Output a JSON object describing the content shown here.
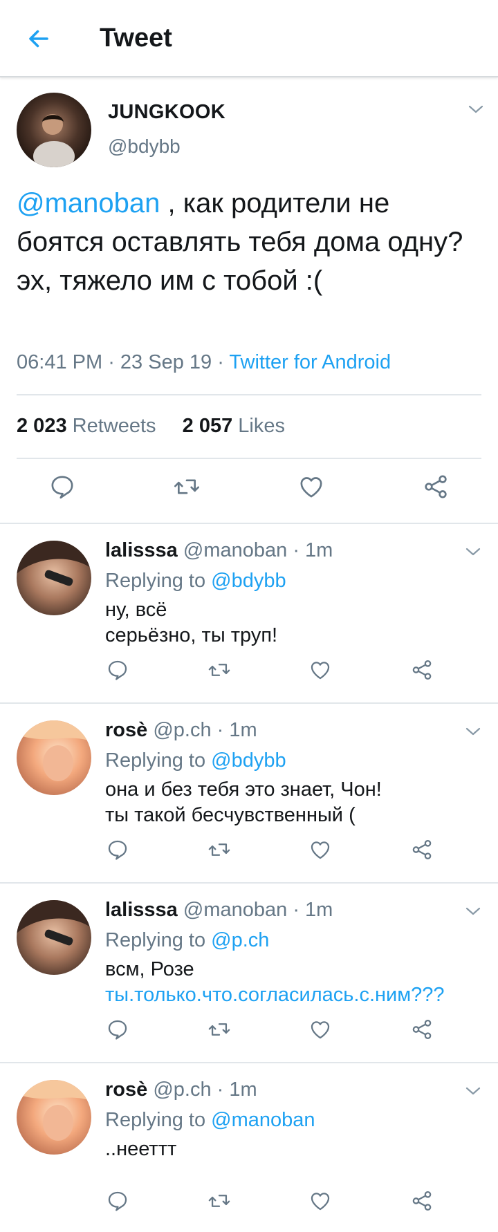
{
  "header": {
    "title": "Tweet",
    "back_icon": "arrow-left-icon",
    "accent": "#1da1f2"
  },
  "tweet": {
    "author_name": "JUNGKOOK",
    "author_handle": "@bdybb",
    "mention": "@manoban",
    "text_rest": " , как родители не боятся оставлять тебя дома одну?",
    "text_line2": "эх, тяжело им с тобой :(",
    "time": "06:41 PM",
    "date": "23 Sep 19",
    "sep": " · ",
    "source": "Twitter for Android",
    "retweets_count": "2 023",
    "retweets_label": " Retweets",
    "likes_count": "2 057",
    "likes_label": " Likes"
  },
  "replies": [
    {
      "name": "lalisssa",
      "handle": "@manoban",
      "time": " · 1m",
      "replying_prefix": "Replying to ",
      "replying_to": "@bdybb",
      "line1": "ну, всё",
      "line2": "серьёзно, ты труп!"
    },
    {
      "name": "rosè",
      "handle": "@p.ch",
      "time": " · 1m",
      "replying_prefix": "Replying to ",
      "replying_to": "@bdybb",
      "line1": "она и без тебя это знает, Чон!",
      "line2": "ты такой бесчувственный ("
    },
    {
      "name": "lalisssa",
      "handle": "@manoban",
      "time": " · 1m",
      "replying_prefix": "Replying to ",
      "replying_to": "@p.ch",
      "line1": "всм, Розе",
      "line2": "ты.только.что.согласилась.с.ним???"
    },
    {
      "name": "rosè",
      "handle": "@p.ch",
      "time": " · 1m",
      "replying_prefix": "Replying to ",
      "replying_to": "@manoban",
      "line1": "..нееттт",
      "line2": ""
    }
  ]
}
